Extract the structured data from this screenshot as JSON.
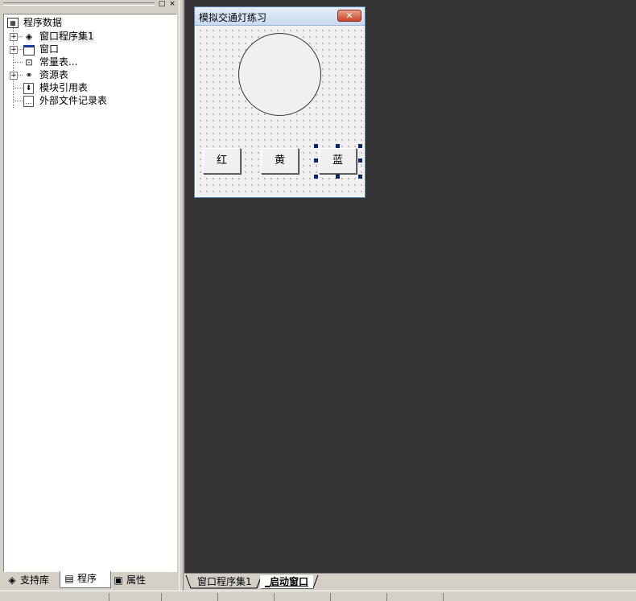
{
  "left_panel": {
    "title_buttons": {
      "restore": "□",
      "close": "×"
    },
    "tree": {
      "root": {
        "label": "程序数据",
        "icon": "program-data-icon"
      },
      "items": [
        {
          "label": "窗口程序集1",
          "icon": "module-stack-icon",
          "expandable": true
        },
        {
          "label": "窗口",
          "icon": "window-icon",
          "expandable": true
        },
        {
          "label": "常量表...",
          "icon": "constant-table-icon",
          "expandable": false
        },
        {
          "label": "资源表",
          "icon": "resource-table-icon",
          "expandable": true
        },
        {
          "label": "模块引用表",
          "icon": "module-reference-icon",
          "expandable": false
        },
        {
          "label": "外部文件记录表",
          "icon": "external-file-icon",
          "expandable": false
        }
      ]
    },
    "tabs": [
      {
        "label": "支持库",
        "icon": "library-icon"
      },
      {
        "label": "程序",
        "icon": "program-icon",
        "active": true
      },
      {
        "label": "属性",
        "icon": "properties-icon"
      }
    ]
  },
  "form": {
    "title": "模拟交通灯练习",
    "close_glyph": "✕",
    "buttons": [
      {
        "label": "红"
      },
      {
        "label": "黄"
      },
      {
        "label": "蓝",
        "selected": true
      }
    ]
  },
  "doc_tabs": [
    {
      "label": "窗口程序集1"
    },
    {
      "label": "_启动窗口",
      "active": true
    }
  ],
  "colors": {
    "workspace": "#333333",
    "panel": "#d4d0c8",
    "selection_handle": "#0a246a",
    "close_button": "#c8442a"
  }
}
